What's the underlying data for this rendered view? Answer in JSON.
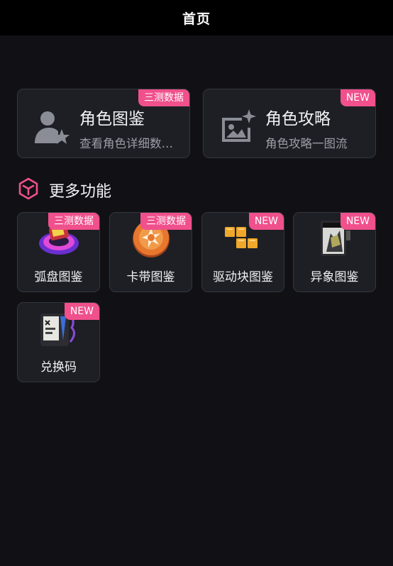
{
  "header": {
    "title": "首页"
  },
  "top_cards": [
    {
      "title": "角色图鉴",
      "subtitle": "查看角色详细数…",
      "badge": "三测数据",
      "icon": "person-star-icon"
    },
    {
      "title": "角色攻略",
      "subtitle": "角色攻略一图流",
      "badge": "NEW",
      "icon": "image-sparkle-icon"
    }
  ],
  "section": {
    "title": "更多功能",
    "icon": "cube-icon"
  },
  "features": [
    {
      "label": "弧盘图鉴",
      "badge": "三测数据",
      "icon": "disc-icon"
    },
    {
      "label": "卡带图鉴",
      "badge": "三测数据",
      "icon": "cassette-emblem-icon"
    },
    {
      "label": "驱动块图鉴",
      "badge": "NEW",
      "icon": "blocks-icon"
    },
    {
      "label": "异象图鉴",
      "badge": "NEW",
      "icon": "card-figure-icon"
    },
    {
      "label": "兑换码",
      "badge": "NEW",
      "icon": "code-device-icon"
    }
  ],
  "colors": {
    "badge": "#f0508c",
    "background": "#111115",
    "card": "#1d1f25",
    "accent": "#f0508c"
  }
}
